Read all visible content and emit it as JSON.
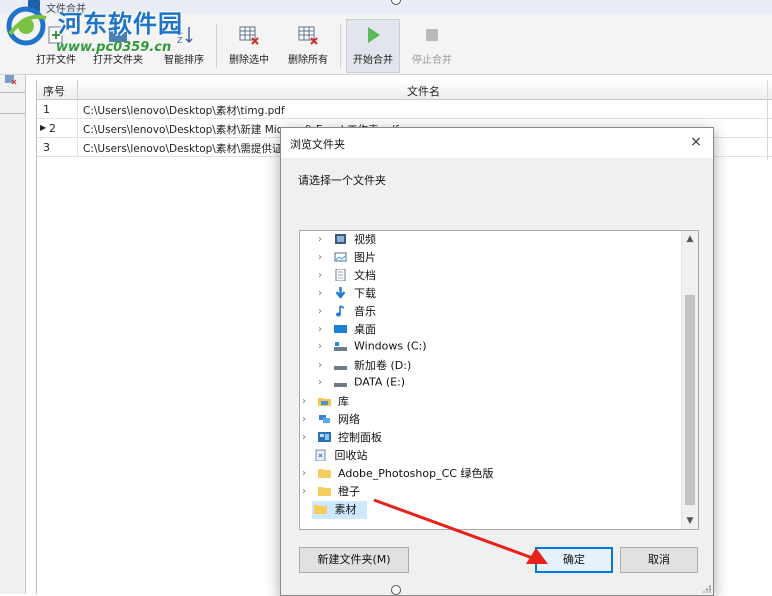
{
  "window": {
    "title": "文件合并"
  },
  "watermark": {
    "title": "河东软件园",
    "url": "www.pc0359.cn"
  },
  "toolbar": {
    "buttons": [
      {
        "label": "打开文件",
        "icon": "open-file-icon"
      },
      {
        "label": "打开文件夹",
        "icon": "open-folder-icon"
      },
      {
        "label": "智能排序",
        "icon": "sort-icon"
      },
      {
        "label": "删除选中",
        "icon": "delete-selected-icon"
      },
      {
        "label": "删除所有",
        "icon": "delete-all-icon"
      },
      {
        "label": "开始合并",
        "icon": "play-icon"
      },
      {
        "label": "停止合并",
        "icon": "stop-icon"
      }
    ]
  },
  "grid": {
    "headers": [
      "序号",
      "文件名"
    ],
    "rows": [
      {
        "index": "1",
        "path": "C:\\Users\\lenovo\\Desktop\\素材\\timg.pdf"
      },
      {
        "index": "2",
        "path": "C:\\Users\\lenovo\\Desktop\\素材\\新建 Microsoft Excel 工作表.pdf"
      },
      {
        "index": "3",
        "path": "C:\\Users\\lenovo\\Desktop\\素材\\需提供证"
      }
    ]
  },
  "dialog": {
    "title": "浏览文件夹",
    "close": "×",
    "prompt": "请选择一个文件夹",
    "tree": [
      {
        "label": "视频",
        "icon": "video-folder-icon"
      },
      {
        "label": "图片",
        "icon": "pictures-folder-icon"
      },
      {
        "label": "文档",
        "icon": "documents-folder-icon"
      },
      {
        "label": "下载",
        "icon": "downloads-folder-icon"
      },
      {
        "label": "音乐",
        "icon": "music-folder-icon"
      },
      {
        "label": "桌面",
        "icon": "desktop-folder-icon"
      },
      {
        "label": "Windows (C:)",
        "icon": "system-drive-icon"
      },
      {
        "label": "新加卷 (D:)",
        "icon": "drive-icon"
      },
      {
        "label": "DATA (E:)",
        "icon": "drive-icon"
      },
      {
        "label": "库",
        "icon": "library-icon"
      },
      {
        "label": "网络",
        "icon": "network-icon"
      },
      {
        "label": "控制面板",
        "icon": "control-panel-icon"
      },
      {
        "label": "回收站",
        "icon": "recycle-bin-icon"
      },
      {
        "label": "Adobe_Photoshop_CC  绿色版",
        "icon": "folder-icon"
      },
      {
        "label": "橙子",
        "icon": "folder-icon"
      },
      {
        "label": "素材",
        "icon": "folder-icon"
      }
    ],
    "new_folder_label": "新建文件夹(M)",
    "ok_label": "确定",
    "cancel_label": "取消"
  },
  "colors": {
    "accent": "#0078d7",
    "selection": "#cde8ff",
    "watermark_blue": "#1f73c9",
    "watermark_green": "#2f9a3a",
    "arrow": "#e8221b"
  }
}
